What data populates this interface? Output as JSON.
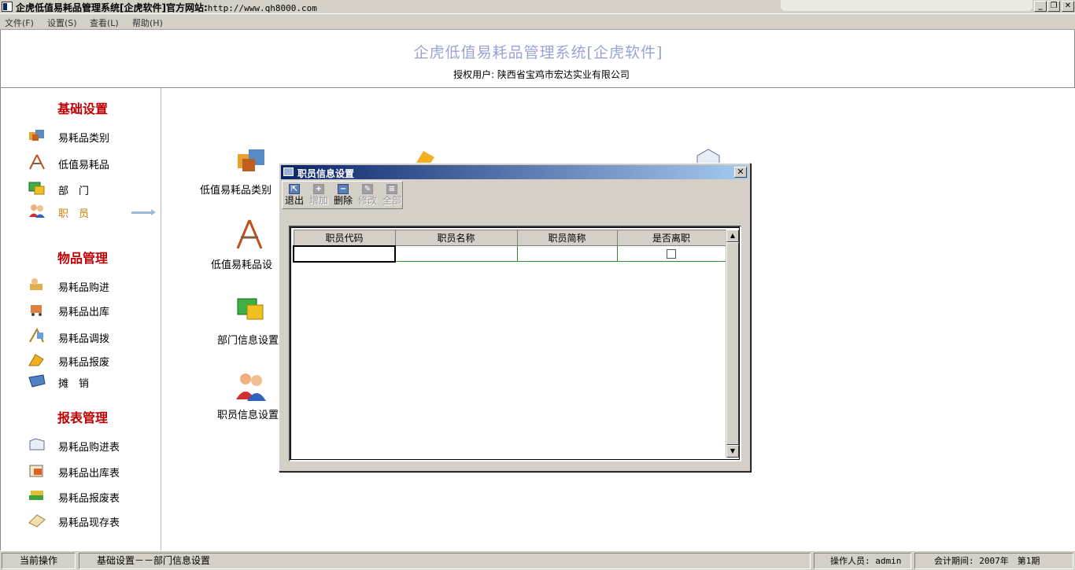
{
  "window": {
    "title": "企虎低值易耗品管理系统[企虎软件]官方网站:",
    "url": "http://www.qh8000.com",
    "controls": {
      "minimize": "_",
      "maximize": "❐",
      "close": "✕"
    }
  },
  "menu": [
    "文件(F)",
    "设置(S)",
    "查看(L)",
    "帮助(H)"
  ],
  "header": {
    "title": "企虎低值易耗品管理系统[企虎软件]",
    "license": "授权用户: 陕西省宝鸡市宏达实业有限公司"
  },
  "sidebar": {
    "sections": [
      {
        "title": "基础设置",
        "items": [
          "易耗品类别",
          "低值易耗品",
          "部　门",
          "职　员"
        ]
      },
      {
        "title": "物品管理",
        "items": [
          "易耗品购进",
          "易耗品出库",
          "易耗品调拨",
          "易耗品报废",
          "摊　销"
        ]
      },
      {
        "title": "报表管理",
        "items": [
          "易耗品购进表",
          "易耗品出库表",
          "易耗品报废表",
          "易耗品现存表"
        ]
      }
    ],
    "active_item": "职　员"
  },
  "main": {
    "shortcuts": [
      "低值易耗品类别",
      "低值易耗品设",
      "部门信息设置",
      "职员信息设置"
    ]
  },
  "dialog": {
    "title": "职员信息设置",
    "close": "✕",
    "toolbar": [
      {
        "label": "退出",
        "enabled": true,
        "icon": "exit-icon"
      },
      {
        "label": "增加",
        "enabled": false,
        "icon": "plus-icon"
      },
      {
        "label": "删除",
        "enabled": true,
        "icon": "minus-icon"
      },
      {
        "label": "修改",
        "enabled": false,
        "icon": "edit-icon"
      },
      {
        "label": "全部",
        "enabled": false,
        "icon": "all-icon"
      }
    ],
    "grid": {
      "columns": [
        "职员代码",
        "职员名称",
        "职员简称",
        "是否离职"
      ],
      "rows": [
        [
          "",
          "",
          "",
          false
        ]
      ]
    }
  },
  "status": {
    "label": "当前操作",
    "current": "基础设置－－部门信息设置",
    "operator": "操作人员: admin",
    "period": "会计期间: 2007年　第1期"
  }
}
